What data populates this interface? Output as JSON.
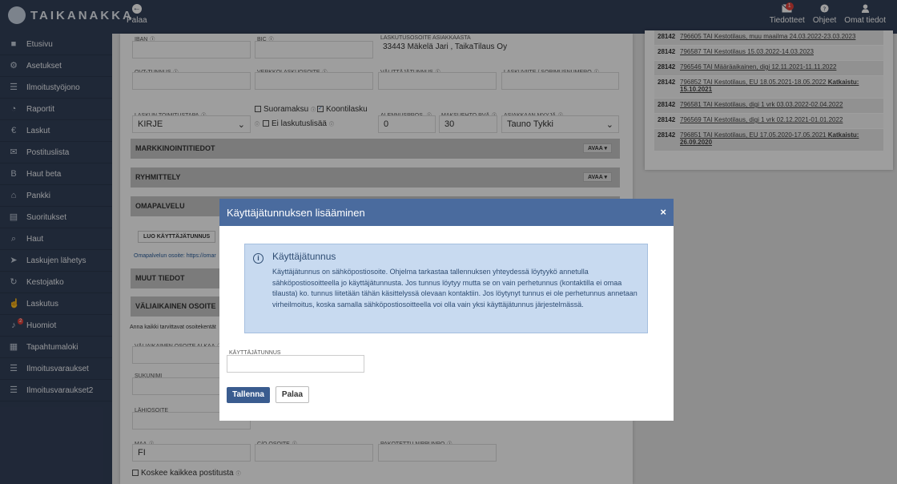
{
  "topbar": {
    "logo_text": "TAIKANAKKA",
    "back_label": "Palaa",
    "messages_label": "Tiedotteet",
    "messages_badge": "1",
    "help_label": "Ohjeet",
    "profile_label": "Omat tiedot"
  },
  "sidebar": {
    "items": [
      {
        "label": "Etusivu",
        "icon": "home-icon"
      },
      {
        "label": "Asetukset",
        "icon": "gear-icon"
      },
      {
        "label": "Ilmoitustyöjono",
        "icon": "list-icon"
      },
      {
        "label": "Raportit",
        "icon": "pie-chart-icon"
      },
      {
        "label": "Laskut",
        "icon": "euro-icon"
      },
      {
        "label": "Postituslista",
        "icon": "envelope-icon"
      },
      {
        "label": "Haut beta",
        "icon": "bitcoin-icon"
      },
      {
        "label": "Pankki",
        "icon": "bank-icon"
      },
      {
        "label": "Suoritukset",
        "icon": "book-icon"
      },
      {
        "label": "Haut",
        "icon": "search-icon"
      },
      {
        "label": "Laskujen lähetys",
        "icon": "send-icon"
      },
      {
        "label": "Kestojatko",
        "icon": "refresh-icon"
      },
      {
        "label": "Laskutus",
        "icon": "thumbs-up-icon"
      },
      {
        "label": "Huomiot",
        "icon": "bell-icon",
        "badge": "2"
      },
      {
        "label": "Tapahtumaloki",
        "icon": "grid-icon"
      },
      {
        "label": "Ilmoitusvaraukset",
        "icon": "list-icon"
      },
      {
        "label": "Ilmoitusvaraukset2",
        "icon": "list-icon"
      }
    ]
  },
  "form": {
    "iban_label": "IBAN",
    "bic_label": "BIC",
    "laskutusosoite_label": "LASKUTUSOSOITE ASIAKKAASTA",
    "laskutusosoite_value": "33443 Mäkelä Jari , TaikaTilaus Oy",
    "ovt_label": "OVT-TUNNUS",
    "verkko_label": "VERKKOLASKUOSOITE",
    "valittaja_label": "VÄLITTÄJÄTUNNUS",
    "viite_label": "LASKUVIITE / SOPIMUSNUMERO",
    "toimitustapa_label": "LASKUN TOIMITUSTAPA",
    "toimitustapa_value": "KIRJE",
    "suoramaksu_label": "Suoramaksu",
    "koontilasku_label": "Koontilasku",
    "ei_laskutuslisaa_label": "Ei laskutuslisää",
    "alennus_label": "ALENNUSPROS.",
    "alennus_value": "0",
    "maksuehto_label": "MAKSUEHTO PVÄ",
    "maksuehto_value": "30",
    "myyja_label": "ASIAKKAAN MYYJÄ",
    "myyja_value": "Tauno Tykki",
    "markkinointi": "MARKKINOINTITIEDOT",
    "ryhmittely": "RYHMITTELY",
    "avaa": "AVAA",
    "omapalvelu": "OMAPALVELU",
    "luo_btn": "LUO KÄYTTÄJÄTUNNUS",
    "omapalvelu_link": "Omapalvelun osoite: https://omar",
    "muut": "MUUT TIEDOT",
    "valiaikainen": "VÄLIAIKAINEN OSOITE",
    "anna_text": "Anna kaikki tarvittavat osoitekentät",
    "alkaa_label": "VÄLIAIKAINEN OSOITE ALKAA",
    "sukunimi_label": "SUKUNIMI",
    "lahiosoite_label": "LÄHIOSOITE",
    "maa_label": "MAA",
    "maa_value": "FI",
    "co_label": "C/O OSOITE",
    "pakotettu_label": "PAKOTETTU NIPPUNRO",
    "koskee_label": "Koskee kaikkea postitusta"
  },
  "history": [
    {
      "id": "28142",
      "text": "796605 TAI Kestotilaus, muu maailma 24.03.2022-23.03.2023",
      "bold": ""
    },
    {
      "id": "28142",
      "text": "796587 TAI Kestotilaus 15.03.2022-14.03.2023",
      "bold": ""
    },
    {
      "id": "28142",
      "text": "796546 TAI Määräaikainen, digi 12.11.2021-11.11.2022",
      "bold": ""
    },
    {
      "id": "28142",
      "text": "796852 TAI Kestotilaus, EU 18.05.2021-18.05.2022 ",
      "bold": "Katkaistu: 15.10.2021"
    },
    {
      "id": "28142",
      "text": "796581 TAI Kestotilaus, digi 1 vrk 03.03.2022-02.04.2022",
      "bold": ""
    },
    {
      "id": "28142",
      "text": "796569 TAI Kestotilaus, digi 1 vrk 02.12.2021-01.01.2022",
      "bold": ""
    },
    {
      "id": "28142",
      "text": "796851 TAI Kestotilaus, EU 17.05.2020-17.05.2021 ",
      "bold": "Katkaistu: 26.09.2020"
    }
  ],
  "modal": {
    "title": "Käyttäjätunnuksen lisääminen",
    "close": "×",
    "info_title": "Käyttäjätunnus",
    "info_text": "Käyttäjätunnus on sähköpostiosoite. Ohjelma tarkastaa tallennuksen yhteydessä löytyykö annetulla sähköpostiosoitteella jo käyttäjätunnusta. Jos tunnus löytyy mutta se on vain perhetunnus (kontaktilla ei omaa tilausta) ko. tunnus liitetään tähän käsittelyssä olevaan kontaktiin. Jos löytynyt tunnus ei ole perhetunnus annetaan virheilmoitus, koska samalla sähköpostiosoitteella voi olla vain yksi käyttäjätunnus järjestelmässä.",
    "field_label": "KÄYTTÄJÄTUNNUS",
    "field_value": "",
    "save": "Tallenna",
    "cancel": "Palaa"
  }
}
